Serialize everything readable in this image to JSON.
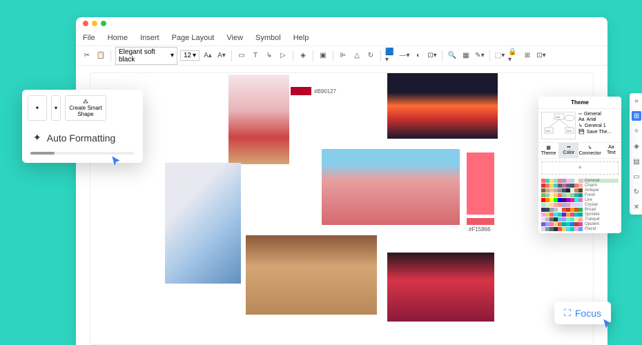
{
  "menu": {
    "file": "File",
    "home": "Home",
    "insert": "Insert",
    "page_layout": "Page Layout",
    "view": "View",
    "symbol": "Symbol",
    "help": "Help"
  },
  "toolbar": {
    "font": "Elegant soft black",
    "size": "12"
  },
  "swatches": {
    "s1": "#B90127",
    "s2": "#F15866"
  },
  "popup": {
    "create_smart": "Create Smart Shape",
    "auto_format": "Auto Formatting"
  },
  "theme": {
    "title": "Theme",
    "opts": {
      "general": "General",
      "arial": "Arial",
      "general1": "General 1",
      "save": "Save The..."
    },
    "tabs": {
      "theme": "Theme",
      "color": "Color",
      "connector": "Connector",
      "text": "Text"
    },
    "palettes": [
      "General",
      "Charm",
      "Antique",
      "Fresh",
      "Live",
      "Crystal",
      "Broad",
      "Sprinkle",
      "Tranquil",
      "Opulent",
      "Placid"
    ]
  },
  "focus": {
    "label": "Focus"
  }
}
